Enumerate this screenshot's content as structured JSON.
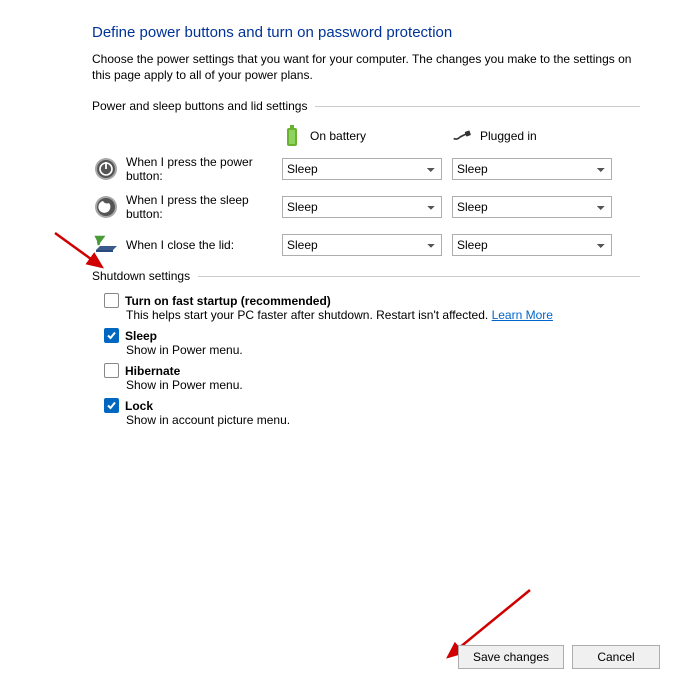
{
  "title": "Define power buttons and turn on password protection",
  "intro": "Choose the power settings that you want for your computer. The changes you make to the settings on this page apply to all of your power plans.",
  "section_power": "Power and sleep buttons and lid settings",
  "section_shutdown": "Shutdown settings",
  "col_battery": "On battery",
  "col_plugged": "Plugged in",
  "rows": {
    "power_btn_label": "When I press the power button:",
    "sleep_btn_label": "When I press the sleep button:",
    "lid_label": "When I close the lid:",
    "power_btn_battery": "Sleep",
    "power_btn_plugged": "Sleep",
    "sleep_btn_battery": "Sleep",
    "sleep_btn_plugged": "Sleep",
    "lid_battery": "Sleep",
    "lid_plugged": "Sleep"
  },
  "shutdown": {
    "fast_title": "Turn on fast startup (recommended)",
    "fast_desc": "This helps start your PC faster after shutdown. Restart isn't affected. ",
    "fast_link": "Learn More",
    "sleep_title": "Sleep",
    "sleep_desc": "Show in Power menu.",
    "hibernate_title": "Hibernate",
    "hibernate_desc": "Show in Power menu.",
    "lock_title": "Lock",
    "lock_desc": "Show in account picture menu."
  },
  "buttons": {
    "save": "Save changes",
    "cancel": "Cancel"
  }
}
